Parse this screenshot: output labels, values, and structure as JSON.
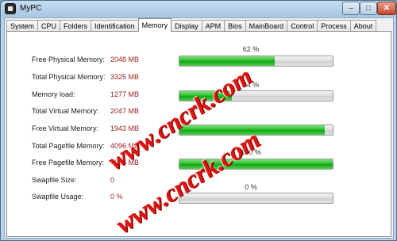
{
  "window": {
    "title": "MyPC",
    "minimize_label": "–",
    "maximize_label": "□",
    "close_label": "✕"
  },
  "tabs": [
    "System",
    "CPU",
    "Folders",
    "Identification",
    "Memory",
    "Display",
    "APM",
    "Bios",
    "MainBoard",
    "Control",
    "Process",
    "About"
  ],
  "active_tab": "Memory",
  "memory": {
    "rows": [
      {
        "label": "Free Physical Memory:",
        "value": "2048 MB"
      },
      {
        "label": "Total Physical Memory:",
        "value": "3325 MB"
      },
      {
        "label": "Memory load:",
        "value": "1277 MB"
      },
      {
        "label": "Total Virtual Memory:",
        "value": "2047 MB"
      },
      {
        "label": "Free Virtual Memory:",
        "value": "1943 MB"
      },
      {
        "label": "Total Pagefile Memory:",
        "value": "4096 MB"
      },
      {
        "label": "Free Pagefile Memory:",
        "value": "4096 MB"
      },
      {
        "label": "Swapfile Size:",
        "value": "0"
      },
      {
        "label": "Swapfile Usage:",
        "value": "0 %"
      }
    ],
    "bars": [
      {
        "percent_label": "62 %",
        "fill": 0.62
      },
      {
        "percent_label": "34 %",
        "fill": 0.34
      },
      {
        "percent_label": "",
        "fill": 0.95
      },
      {
        "percent_label": "100 %",
        "fill": 1.0
      },
      {
        "percent_label": "0 %",
        "fill": 0.0
      }
    ]
  },
  "watermark": {
    "text": "www.cncrk.com"
  }
}
